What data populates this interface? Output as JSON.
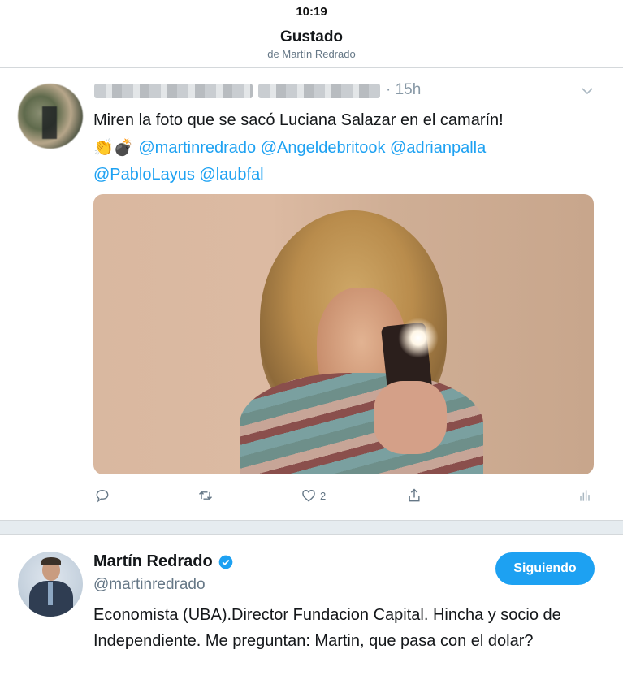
{
  "status_bar": {
    "time": "10:19"
  },
  "header": {
    "title": "Gustado",
    "subtitle": "de Martín Redrado"
  },
  "tweet": {
    "time": "· 15h",
    "text": "Miren la foto que se sacó Luciana Salazar en el camarín!",
    "emojis": "👏💣",
    "mentions": [
      "@martinredrado",
      "@Angeldebritoοk",
      "@adrianpalla",
      "@PabloLayus",
      "@laubfal"
    ],
    "actions": {
      "reply_icon": "reply-icon",
      "retweet_icon": "retweet-icon",
      "like_icon": "heart-icon",
      "like_count": "2",
      "share_icon": "share-icon",
      "analytics_icon": "analytics-icon"
    }
  },
  "profile": {
    "name": "Martín Redrado",
    "handle": "@martinredrado",
    "follow_label": "Siguiendo",
    "bio": "Economista (UBA).Director Fundacion Capital. Hincha y socio de Independiente. Me preguntan: Martin, que pasa con el dolar?"
  },
  "colors": {
    "accent": "#1da1f2",
    "secondary_text": "#657786",
    "divider": "#e6ecf0"
  }
}
